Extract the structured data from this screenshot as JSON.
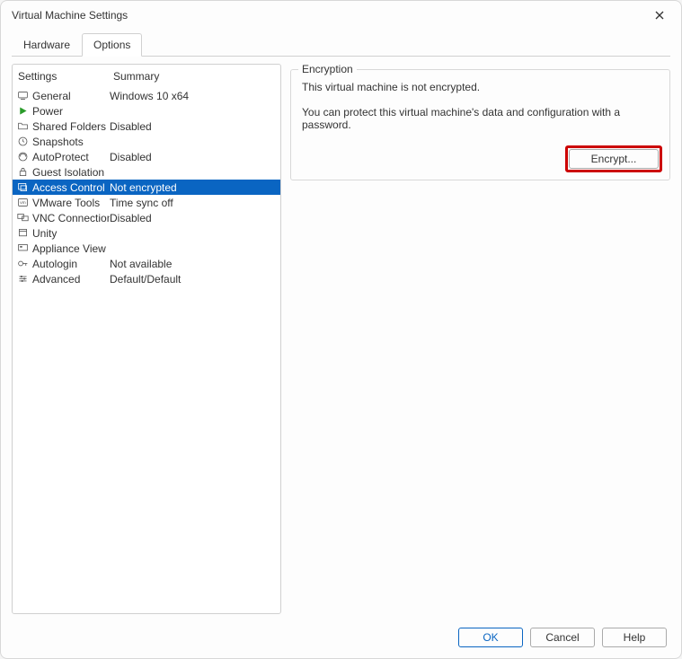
{
  "window": {
    "title": "Virtual Machine Settings"
  },
  "tabs": {
    "hardware": "Hardware",
    "options": "Options"
  },
  "headers": {
    "settings": "Settings",
    "summary": "Summary"
  },
  "rows": {
    "general": {
      "label": "General",
      "summary": "Windows 10 x64"
    },
    "power": {
      "label": "Power",
      "summary": ""
    },
    "sharedfolders": {
      "label": "Shared Folders",
      "summary": "Disabled"
    },
    "snapshots": {
      "label": "Snapshots",
      "summary": ""
    },
    "autoprotect": {
      "label": "AutoProtect",
      "summary": "Disabled"
    },
    "guestiso": {
      "label": "Guest Isolation",
      "summary": ""
    },
    "access": {
      "label": "Access Control",
      "summary": "Not encrypted"
    },
    "vmwaretools": {
      "label": "VMware Tools",
      "summary": "Time sync off"
    },
    "vnc": {
      "label": "VNC Connections",
      "summary": "Disabled"
    },
    "unity": {
      "label": "Unity",
      "summary": ""
    },
    "appliance": {
      "label": "Appliance View",
      "summary": ""
    },
    "autologin": {
      "label": "Autologin",
      "summary": "Not available"
    },
    "advanced": {
      "label": "Advanced",
      "summary": "Default/Default"
    }
  },
  "detail": {
    "group_label": "Encryption",
    "line1": "This virtual machine is not encrypted.",
    "line2": "You can protect this virtual machine's data and configuration with a password.",
    "encrypt_btn": "Encrypt..."
  },
  "footer": {
    "ok": "OK",
    "cancel": "Cancel",
    "help": "Help"
  }
}
